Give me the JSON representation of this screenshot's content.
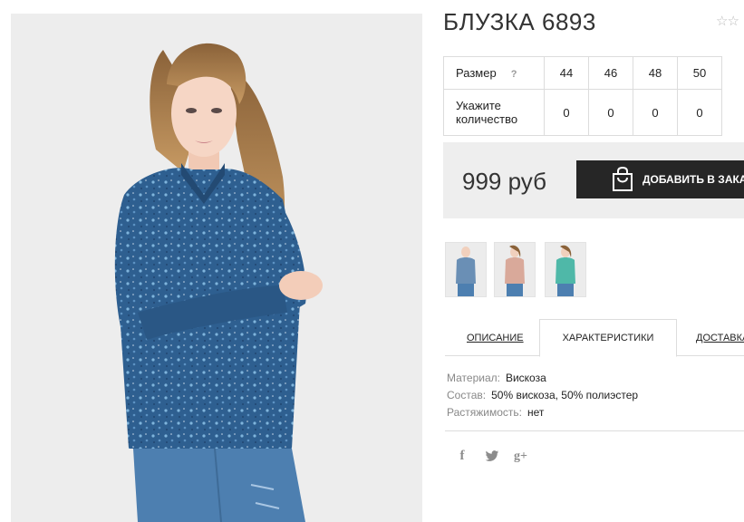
{
  "product": {
    "title": "БЛУЗКА 6893",
    "rating_icons": [
      "star-outline-icon",
      "star-outline-icon"
    ]
  },
  "size_table": {
    "size_label": "Размер",
    "help_label": "?",
    "sizes": [
      "44",
      "46",
      "48",
      "50"
    ],
    "qty_label": "Укажите количество",
    "quantities": [
      "0",
      "0",
      "0",
      "0"
    ]
  },
  "buy": {
    "price": "999 руб",
    "add_button_label": "ДОБАВИТЬ В ЗАКАЗ",
    "button_icon": "shopping-bag-icon"
  },
  "thumbnails": [
    {
      "name": "thumb-blue-blouse",
      "color": "#6a8fb5"
    },
    {
      "name": "thumb-beige-blouse",
      "color": "#d9a99a"
    },
    {
      "name": "thumb-mint-blouse",
      "color": "#4fb8a8"
    }
  ],
  "tabs": [
    {
      "label": "ОПИСАНИЕ",
      "active": false
    },
    {
      "label": "ХАРАКТЕРИСТИКИ",
      "active": true
    },
    {
      "label": "ДОСТАВКА",
      "active": false
    }
  ],
  "specs": [
    {
      "key": "Материал:",
      "value": "Вискоза"
    },
    {
      "key": "Состав:",
      "value": "50% вискоза, 50% полиэстер"
    },
    {
      "key": "Растяжимость:",
      "value": "нет"
    }
  ],
  "share": {
    "facebook_glyph": "f",
    "twitter_icon": "twitter-icon",
    "googleplus_glyph": "g+"
  },
  "colors": {
    "button_bg": "#262626",
    "buy_box_bg": "#eeeeee",
    "blouse_blue": "#2f5f91",
    "jeans_blue": "#4d7fb0"
  }
}
